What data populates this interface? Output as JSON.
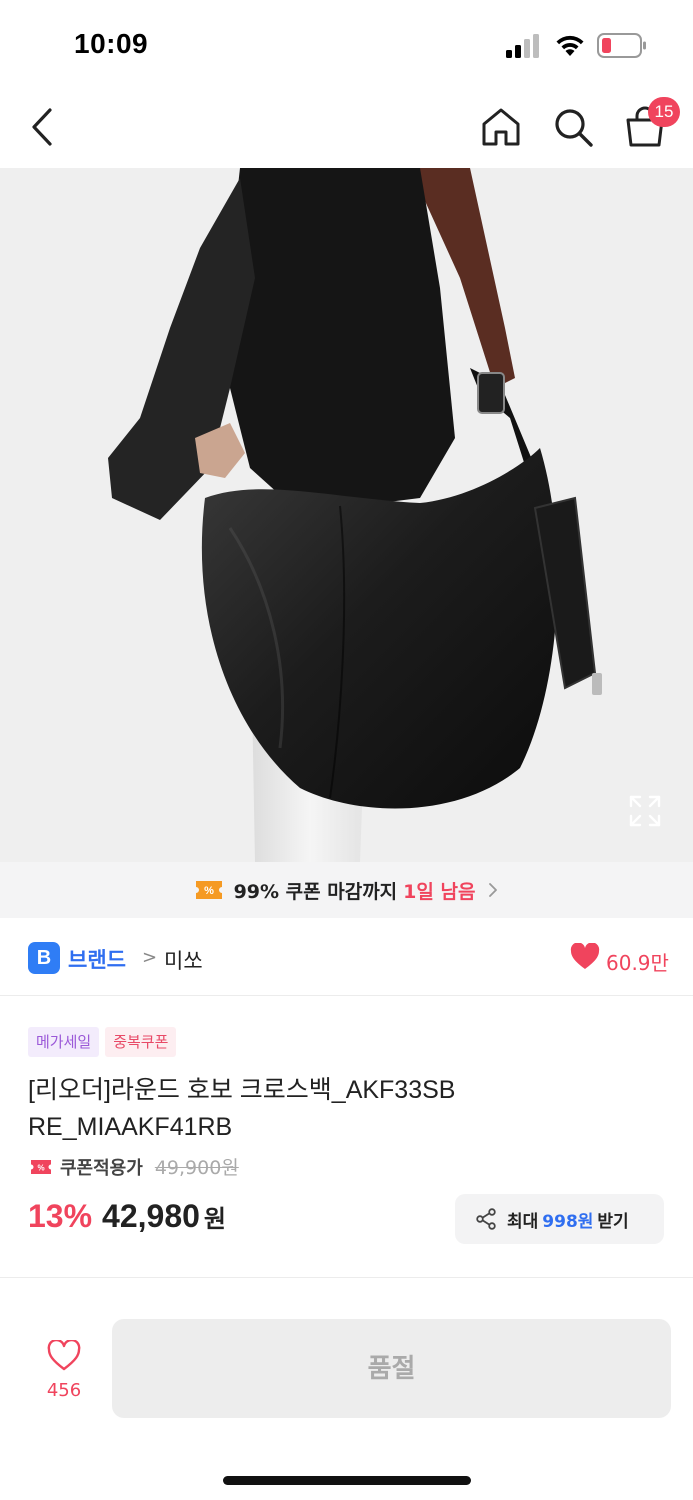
{
  "status_bar": {
    "time": "10:09",
    "battery_color": "#f0445d"
  },
  "nav": {
    "back_icon": "chevron-left-icon",
    "home_icon": "home-icon",
    "search_icon": "search-icon",
    "cart_icon": "shopping-bag-icon",
    "cart_badge": "15"
  },
  "image": {
    "subject": "black leather round hobo crossbody bag",
    "expand_icon": "expand-icon"
  },
  "coupon_banner": {
    "text": "99% 쿠폰 마감까지",
    "remaining": "1일 남음"
  },
  "brand": {
    "badge": "B",
    "label": "브랜드",
    "separator": ">",
    "name": "미쏘",
    "likes": "60.9만"
  },
  "tags": [
    "메가세일",
    "중복쿠폰"
  ],
  "product": {
    "title": "[리오더]라운드 호보 크로스백_AKF33SB RE_MIAAKF41RB",
    "coupon_label": "쿠폰적용가",
    "original_price": "49,900원",
    "discount": "13%",
    "price": "42,980",
    "currency": "원"
  },
  "share": {
    "prefix": "최대",
    "amount": "998원",
    "suffix": "받기"
  },
  "bottom": {
    "wish_count": "456",
    "soldout_label": "품절"
  },
  "colors": {
    "accent_red": "#f0445d",
    "accent_blue": "#2f6ef0",
    "coupon_orange": "#f59a23"
  }
}
